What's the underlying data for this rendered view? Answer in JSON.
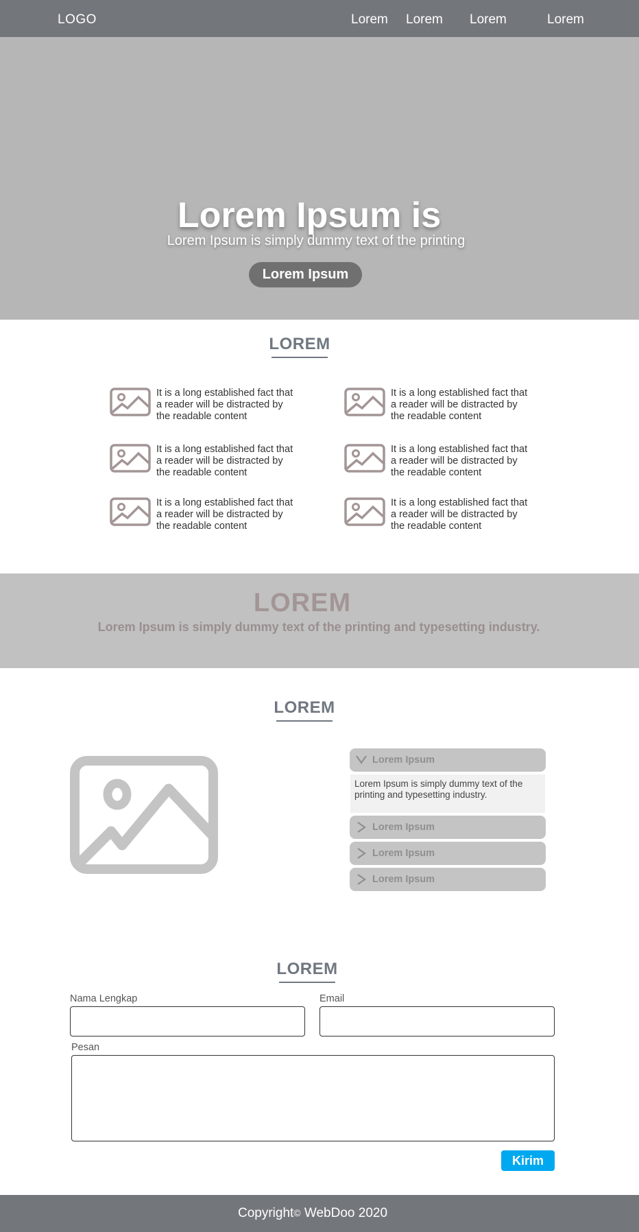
{
  "nav": {
    "logo": "LOGO",
    "links": [
      "Lorem",
      "Lorem",
      "Lorem",
      "Lorem"
    ]
  },
  "hero": {
    "title": "Lorem Ipsum is",
    "subtitle": "Lorem Ipsum is simply dummy text of the printing",
    "button_label": "Lorem Ipsum"
  },
  "features": {
    "title": "LOREM",
    "items": [
      {
        "text": "It is a long established fact that a reader will be distracted by the readable content",
        "icon": "image-icon"
      },
      {
        "text": "It is a long established fact that a reader will be distracted by the readable content",
        "icon": "image-icon"
      },
      {
        "text": "It is a long established fact that a reader will be distracted by the readable content",
        "icon": "image-icon"
      },
      {
        "text": "It is a long established fact that a reader will be distracted by the readable content",
        "icon": "image-icon"
      },
      {
        "text": "It is a long established fact that a reader will be distracted by the readable content",
        "icon": "image-icon"
      },
      {
        "text": "It is a long established fact that a reader will be distracted by the readable content",
        "icon": "image-icon"
      }
    ]
  },
  "banner": {
    "title": "LOREM",
    "text": "Lorem Ipsum is simply dummy text of the printing and typesetting industry."
  },
  "faq": {
    "title": "LOREM",
    "image_icon": "image-icon",
    "items": [
      {
        "label": "Lorem Ipsum",
        "expanded": true,
        "content": "Lorem Ipsum is simply dummy text of the printing and typesetting industry."
      },
      {
        "label": "Lorem Ipsum",
        "expanded": false
      },
      {
        "label": "Lorem Ipsum",
        "expanded": false
      },
      {
        "label": "Lorem Ipsum",
        "expanded": false
      }
    ]
  },
  "contact": {
    "title": "LOREM",
    "name_label": "Nama Lengkap",
    "name_value": "",
    "email_label": "Email",
    "email_value": "",
    "message_label": "Pesan",
    "message_value": "",
    "submit_label": "Kirim"
  },
  "footer": {
    "text_before": "Copyright",
    "symbol": "©",
    "text_after": " WebDoo 2020"
  },
  "colors": {
    "nav_bg": "#73777b",
    "hero_bg": "#b6b6b6",
    "banner_bg": "#c1c1c1",
    "accent": "#00a8f0",
    "icon": "#a39596"
  }
}
